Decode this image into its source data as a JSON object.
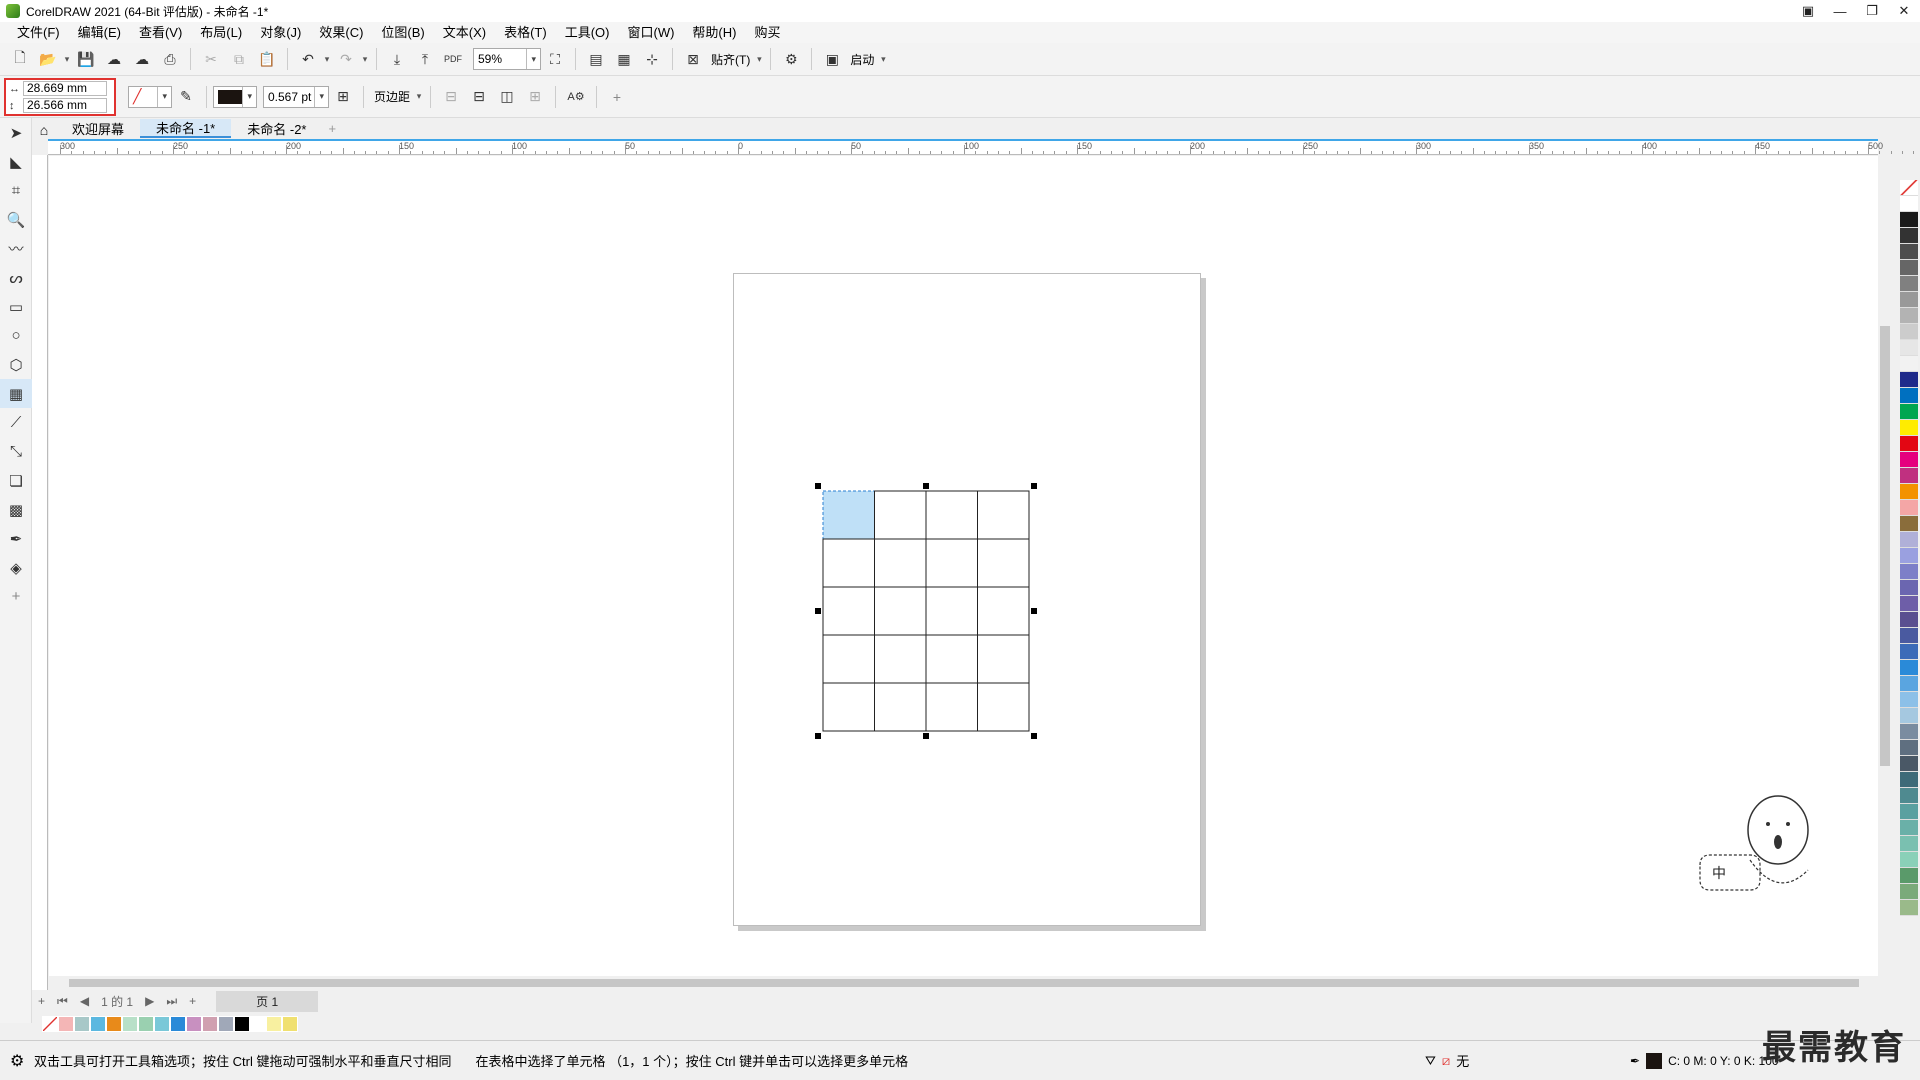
{
  "window": {
    "title": "CorelDRAW 2021 (64-Bit 评估版) - 未命名 -1*",
    "controls": [
      "▣",
      "—",
      "❐",
      "✕"
    ]
  },
  "menu": [
    "文件(F)",
    "编辑(E)",
    "查看(V)",
    "布局(L)",
    "对象(J)",
    "效果(C)",
    "位图(B)",
    "文本(X)",
    "表格(T)",
    "工具(O)",
    "窗口(W)",
    "帮助(H)",
    "购买"
  ],
  "toolbar": {
    "zoom_value": "59%",
    "snap_label": "贴齐(T)",
    "launch_label": "启动"
  },
  "propertybar": {
    "width_value": "28.669 mm",
    "height_value": "26.566 mm",
    "outline_width": "0.567 pt",
    "margin_label": "页边距",
    "outline_color": "#1b1410"
  },
  "tabs": {
    "welcome": "欢迎屏幕",
    "doc1": "未命名 -1*",
    "doc2": "未命名 -2*",
    "add": "+"
  },
  "ruler": {
    "labels": [
      "300",
      "250",
      "200",
      "150",
      "100",
      "50",
      "0",
      "50",
      "100",
      "150",
      "200",
      "250",
      "300",
      "350",
      "400",
      "450",
      "500"
    ],
    "unit": "毫米"
  },
  "table": {
    "rows": 5,
    "cols": 4,
    "selected_cell": [
      1,
      1
    ]
  },
  "pagenav": {
    "page_of": "1 的 1",
    "page_tab": "页 1"
  },
  "palette_colors": [
    "#ffffff",
    "#1a1a1a",
    "#333333",
    "#4d4d4d",
    "#666666",
    "#808080",
    "#999999",
    "#b3b3b3",
    "#cccccc",
    "#e6e6e6",
    "#f2f2f2",
    "#1f2a8a",
    "#0070c0",
    "#00a651",
    "#ffec00",
    "#e30613",
    "#e5007e",
    "#c03080",
    "#f39200",
    "#f4a6a6",
    "#8a6d3b",
    "#b0b0d8",
    "#9aa0e0",
    "#7d7fc8",
    "#6b66b0",
    "#6e5ea8",
    "#5a4f90",
    "#4a5aa0",
    "#3c6bb8",
    "#2a8ad8",
    "#5aa5e0",
    "#8cc0e8",
    "#a5c8e0",
    "#7a8ca0",
    "#5f6f80",
    "#4a5866",
    "#3d6a78",
    "#4f8a90",
    "#5aa0a0",
    "#6ab0a8",
    "#7ac0b0",
    "#8ad0b8",
    "#5a9a6a",
    "#7aaa7a",
    "#9aba8a"
  ],
  "doc_palette": [
    "#f4b6b6",
    "#a8c8c8",
    "#5bb8e0",
    "#e88a1a",
    "#b8e0c8",
    "#9ad0b0",
    "#7ac8d8",
    "#2a8ad8",
    "#c890c0",
    "#d0a0b0",
    "#a0a8b8",
    "#000000",
    "#ffffff",
    "#f8f0a0",
    "#f0e070"
  ],
  "status": {
    "hint": "双击工具可打开工具箱选项；按住 Ctrl 键拖动可强制水平和垂直尺寸相同",
    "selection": "在表格中选择了单元格 （1，1 个）；按住 Ctrl 键并单击可以选择更多单元格",
    "fill": "无",
    "outline": "C: 0 M: 0 Y: 0 K: 100"
  },
  "watermark": "最需教育",
  "mascot_text": "中"
}
